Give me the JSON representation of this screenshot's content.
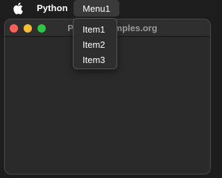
{
  "menubar": {
    "apple_icon": "apple-icon",
    "app_name": "Python",
    "menu1_label": "Menu1"
  },
  "window": {
    "title": "PythonExamples.org",
    "traffic_lights": {
      "close_color": "#ff5f57",
      "minimize_color": "#febc2e",
      "zoom_color": "#28c840"
    }
  },
  "dropdown": {
    "items": [
      {
        "label": "Item1"
      },
      {
        "label": "Item2"
      },
      {
        "label": "Item3"
      }
    ]
  }
}
